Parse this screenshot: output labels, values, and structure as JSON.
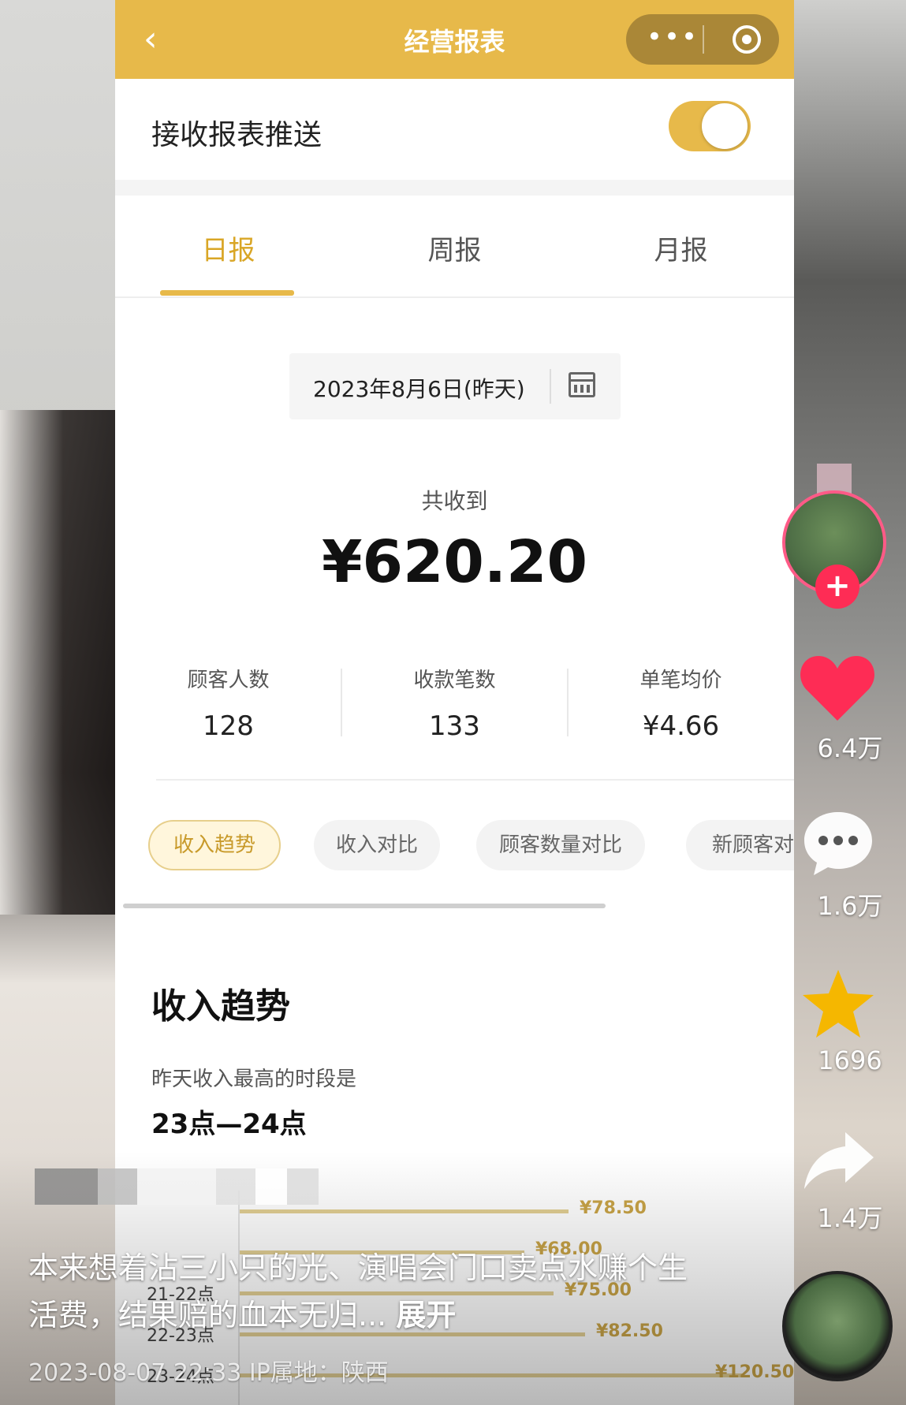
{
  "nav": {
    "back": "‹",
    "title": "经营报表",
    "more": "•••"
  },
  "push": {
    "label": "接收报表推送",
    "enabled": true
  },
  "tabs": [
    {
      "label": "日报",
      "active": true
    },
    {
      "label": "周报",
      "active": false
    },
    {
      "label": "月报",
      "active": false
    }
  ],
  "date": {
    "text": "2023年8月6日(昨天)"
  },
  "summary": {
    "label": "共收到",
    "amount": "¥620.20"
  },
  "stats": [
    {
      "label": "顾客人数",
      "value": "128"
    },
    {
      "label": "收款笔数",
      "value": "133"
    },
    {
      "label": "单笔均价",
      "value": "¥4.66"
    }
  ],
  "chips": [
    {
      "label": "收入趋势",
      "active": true
    },
    {
      "label": "收入对比",
      "active": false
    },
    {
      "label": "顾客数量对比",
      "active": false
    },
    {
      "label": "新顾客对",
      "active": false
    }
  ],
  "trend": {
    "title": "收入趋势",
    "subtitle": "昨天收入最高的时段是",
    "peak": "23点—24点"
  },
  "chart_data": {
    "type": "bar",
    "orientation": "horizontal",
    "categories": [
      "",
      "",
      "21-22点",
      "22-23点",
      "23-24点"
    ],
    "values": [
      78.5,
      68.0,
      75.0,
      82.5,
      120.5
    ],
    "value_labels": [
      "¥78.50",
      "¥68.00",
      "¥75.00",
      "¥82.50",
      "¥120.50"
    ],
    "color": "#e2cf94"
  },
  "overlay": {
    "caption": "本来想着沾三小只的光、演唱会门口卖点水赚个生活费，结果赔的血本无归...",
    "more": "展开",
    "meta": "2023-08-07 22:33  IP属地：陕西"
  },
  "side": {
    "likes": "6.4万",
    "comments": "1.6万",
    "favorites": "1696",
    "shares": "1.4万"
  },
  "colors": {
    "accent": "#e7b94a",
    "accent_text": "#d9a626",
    "like": "#fe2c55",
    "star": "#f5b700"
  }
}
